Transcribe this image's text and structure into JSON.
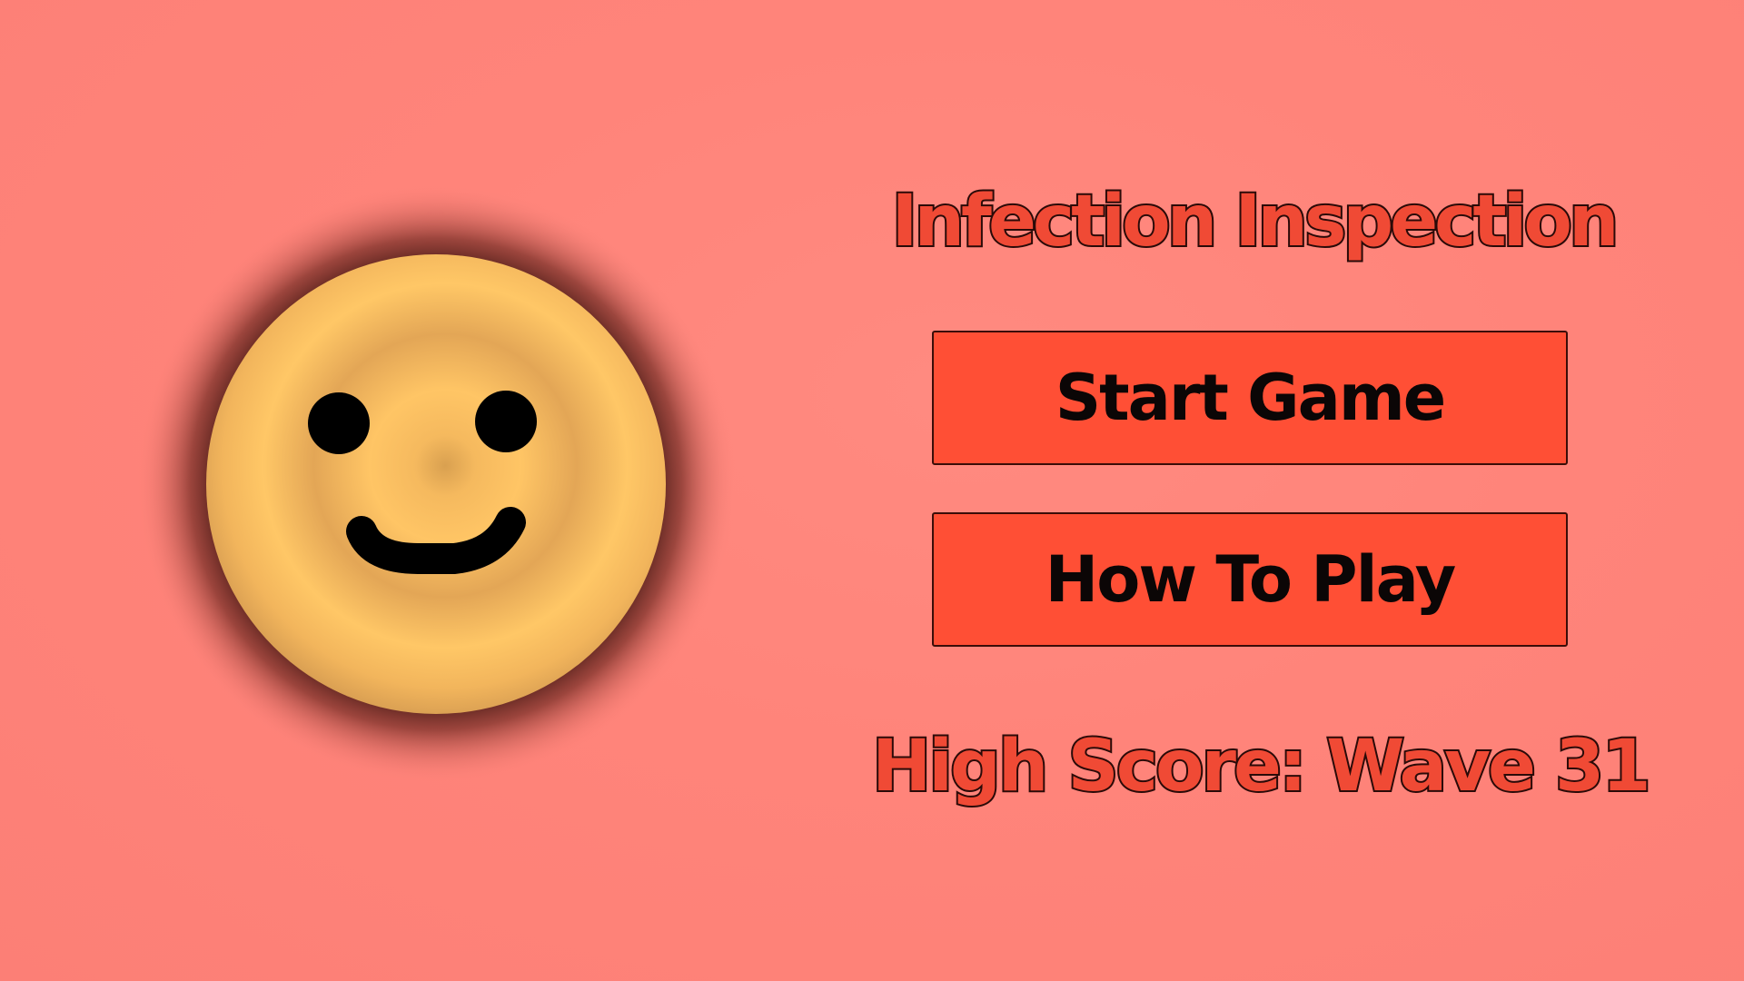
{
  "game": {
    "title": "Infection Inspection",
    "background_color": "#ff857b",
    "accent_color": "#ff4f35"
  },
  "mascot": {
    "icon": "smiley-cell-icon",
    "body_color": "#f7b25a"
  },
  "menu": {
    "start_label": "Start Game",
    "howto_label": "How To Play"
  },
  "high_score": {
    "text": "High Score: Wave 31"
  }
}
